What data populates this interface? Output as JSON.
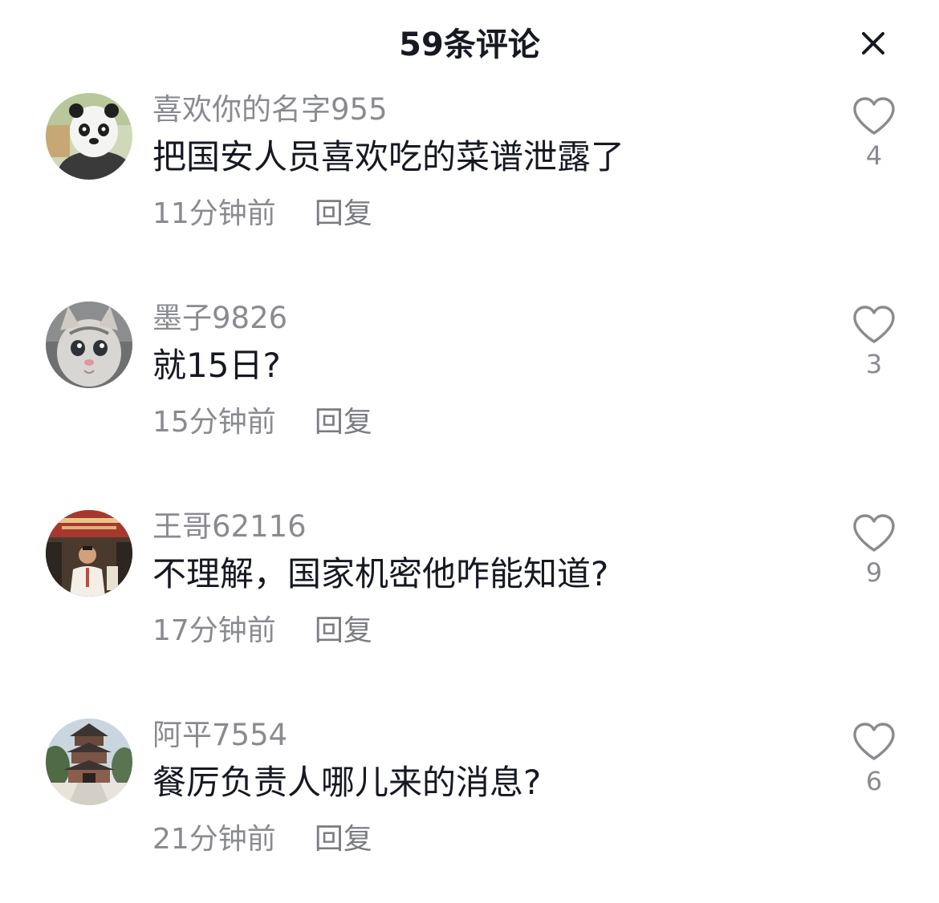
{
  "header": {
    "title": "59条评论",
    "close_icon": "close-icon"
  },
  "comments": [
    {
      "username": "喜欢你的名字955",
      "text": "把国安人员喜欢吃的菜谱泄露了",
      "time": "11分钟前",
      "reply_label": "回复",
      "likes": "4",
      "avatar": "panda-cartoon-avatar"
    },
    {
      "username": "墨子9826",
      "text": "就15日?",
      "time": "15分钟前",
      "reply_label": "回复",
      "likes": "3",
      "avatar": "cat-photo-avatar"
    },
    {
      "username": "王哥62116",
      "text": "不理解，国家机密他咋能知道?",
      "time": "17分钟前",
      "reply_label": "回复",
      "likes": "9",
      "avatar": "man-photo-avatar"
    },
    {
      "username": "阿平7554",
      "text": "餐厉负责人哪儿来的消息?",
      "time": "21分钟前",
      "reply_label": "回复",
      "likes": "6",
      "avatar": "pagoda-photo-avatar"
    }
  ],
  "colors": {
    "text_primary": "#161823",
    "text_secondary": "#8a8b91",
    "background": "#ffffff"
  }
}
